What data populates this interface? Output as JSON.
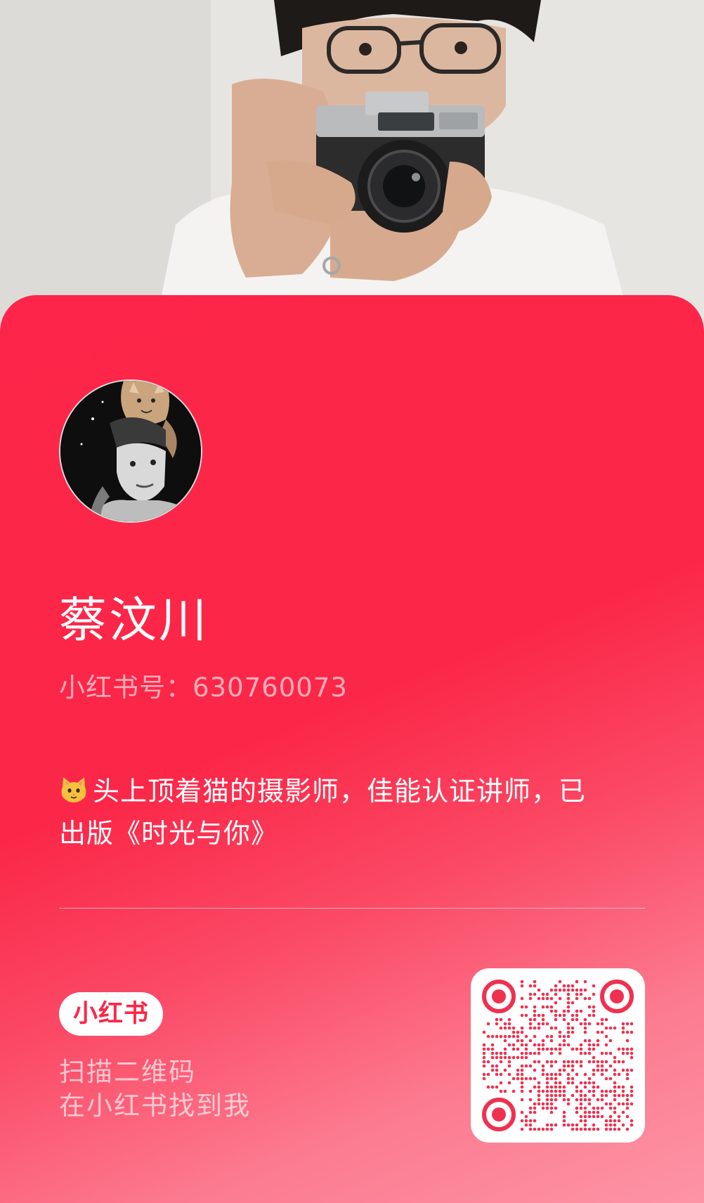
{
  "profile": {
    "name": "蔡汶川",
    "id_label": "小红书号：",
    "id_value": "630760073",
    "bio_emoji": "cat-face-icon",
    "bio_line1": "头上顶着猫的摄影师，佳能认证讲师，已",
    "bio_line2": "出版《时光与你》"
  },
  "footer": {
    "brand_label": "小红书",
    "scan_line1": "扫描二维码",
    "scan_line2": "在小红书找到我"
  },
  "colors": {
    "card_red": "#fb2748",
    "card_pink": "#fd94a6",
    "qr_red": "#f0304f"
  }
}
